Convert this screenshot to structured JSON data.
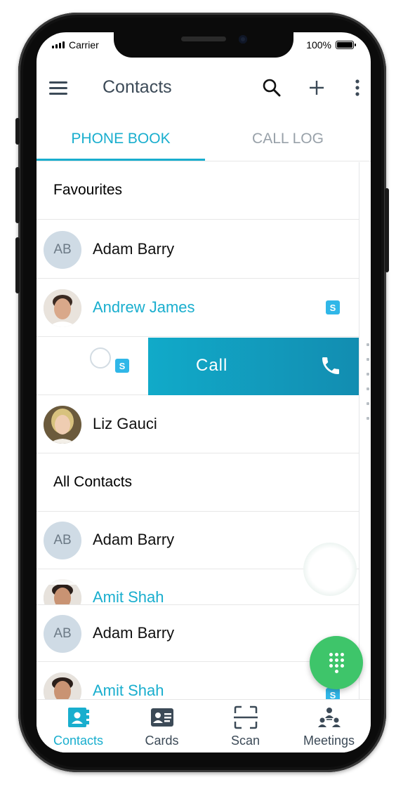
{
  "status_bar": {
    "carrier": "Carrier",
    "battery": "100%"
  },
  "app_bar": {
    "title": "Contacts"
  },
  "tabs": [
    {
      "label": "PHONE BOOK",
      "active": true
    },
    {
      "label": "CALL LOG",
      "active": false
    }
  ],
  "favourites": {
    "header": "Favourites",
    "items": [
      {
        "initials": "AB",
        "name": "Adam Barry",
        "highlight": false
      },
      {
        "initials": "",
        "name": "Andrew James",
        "highlight": true,
        "skype": true
      }
    ],
    "swipe_action": {
      "label": "Call"
    },
    "after": {
      "initials": "",
      "name": "Liz Gauci"
    }
  },
  "all_contacts": {
    "header": "All Contacts",
    "items": [
      {
        "initials": "AB",
        "name": "Adam Barry"
      },
      {
        "initials": "",
        "name": "Amit Shah"
      },
      {
        "initials": "AB",
        "name": "Adam Barry"
      },
      {
        "initials": "",
        "name": "Amit Shah"
      }
    ]
  },
  "bottom_nav": [
    {
      "label": "Contacts",
      "icon": "contacts-book-icon",
      "active": true
    },
    {
      "label": "Cards",
      "icon": "id-card-icon",
      "active": false
    },
    {
      "label": "Scan",
      "icon": "scan-frame-icon",
      "active": false
    },
    {
      "label": "Meetings",
      "icon": "meeting-people-icon",
      "active": false
    }
  ],
  "colors": {
    "accent": "#19aece",
    "fab": "#3ec56a",
    "text_dark": "#3c4a57",
    "call_bg": "#128db1"
  }
}
